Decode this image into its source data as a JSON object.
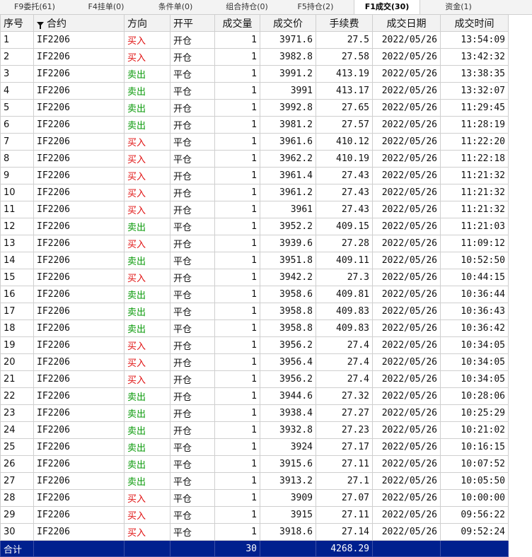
{
  "tabs": [
    {
      "label": "F9委托(61)",
      "active": false
    },
    {
      "label": "F4挂单(0)",
      "active": false
    },
    {
      "label": "条件单(0)",
      "active": false
    },
    {
      "label": "组合持仓(0)",
      "active": false
    },
    {
      "label": "F5持仓(2)",
      "active": false
    },
    {
      "label": "F1成交(30)",
      "active": true
    },
    {
      "label": "资金(1)",
      "active": false
    }
  ],
  "columns": [
    "序号",
    "合约",
    "方向",
    "开平",
    "成交量",
    "成交价",
    "手续费",
    "成交日期",
    "成交时间"
  ],
  "colors": {
    "buy": "#e01010",
    "sell": "#0a9a0a",
    "total_bg": "#00208e"
  },
  "rows": [
    [
      "1",
      "IF2206",
      "买入",
      "开仓",
      "1",
      "3971.6",
      "27.5",
      "2022/05/26",
      "13:54:09"
    ],
    [
      "2",
      "IF2206",
      "买入",
      "开仓",
      "1",
      "3982.8",
      "27.58",
      "2022/05/26",
      "13:42:32"
    ],
    [
      "3",
      "IF2206",
      "卖出",
      "平仓",
      "1",
      "3991.2",
      "413.19",
      "2022/05/26",
      "13:38:35"
    ],
    [
      "4",
      "IF2206",
      "卖出",
      "平仓",
      "1",
      "3991",
      "413.17",
      "2022/05/26",
      "13:32:07"
    ],
    [
      "5",
      "IF2206",
      "卖出",
      "开仓",
      "1",
      "3992.8",
      "27.65",
      "2022/05/26",
      "11:29:45"
    ],
    [
      "6",
      "IF2206",
      "卖出",
      "开仓",
      "1",
      "3981.2",
      "27.57",
      "2022/05/26",
      "11:28:19"
    ],
    [
      "7",
      "IF2206",
      "买入",
      "平仓",
      "1",
      "3961.6",
      "410.12",
      "2022/05/26",
      "11:22:20"
    ],
    [
      "8",
      "IF2206",
      "买入",
      "平仓",
      "1",
      "3962.2",
      "410.19",
      "2022/05/26",
      "11:22:18"
    ],
    [
      "9",
      "IF2206",
      "买入",
      "开仓",
      "1",
      "3961.4",
      "27.43",
      "2022/05/26",
      "11:21:32"
    ],
    [
      "10",
      "IF2206",
      "买入",
      "开仓",
      "1",
      "3961.2",
      "27.43",
      "2022/05/26",
      "11:21:32"
    ],
    [
      "11",
      "IF2206",
      "买入",
      "开仓",
      "1",
      "3961",
      "27.43",
      "2022/05/26",
      "11:21:32"
    ],
    [
      "12",
      "IF2206",
      "卖出",
      "平仓",
      "1",
      "3952.2",
      "409.15",
      "2022/05/26",
      "11:21:03"
    ],
    [
      "13",
      "IF2206",
      "买入",
      "开仓",
      "1",
      "3939.6",
      "27.28",
      "2022/05/26",
      "11:09:12"
    ],
    [
      "14",
      "IF2206",
      "卖出",
      "平仓",
      "1",
      "3951.8",
      "409.11",
      "2022/05/26",
      "10:52:50"
    ],
    [
      "15",
      "IF2206",
      "买入",
      "开仓",
      "1",
      "3942.2",
      "27.3",
      "2022/05/26",
      "10:44:15"
    ],
    [
      "16",
      "IF2206",
      "卖出",
      "平仓",
      "1",
      "3958.6",
      "409.81",
      "2022/05/26",
      "10:36:44"
    ],
    [
      "17",
      "IF2206",
      "卖出",
      "平仓",
      "1",
      "3958.8",
      "409.83",
      "2022/05/26",
      "10:36:43"
    ],
    [
      "18",
      "IF2206",
      "卖出",
      "平仓",
      "1",
      "3958.8",
      "409.83",
      "2022/05/26",
      "10:36:42"
    ],
    [
      "19",
      "IF2206",
      "买入",
      "开仓",
      "1",
      "3956.2",
      "27.4",
      "2022/05/26",
      "10:34:05"
    ],
    [
      "20",
      "IF2206",
      "买入",
      "开仓",
      "1",
      "3956.4",
      "27.4",
      "2022/05/26",
      "10:34:05"
    ],
    [
      "21",
      "IF2206",
      "买入",
      "开仓",
      "1",
      "3956.2",
      "27.4",
      "2022/05/26",
      "10:34:05"
    ],
    [
      "22",
      "IF2206",
      "卖出",
      "开仓",
      "1",
      "3944.6",
      "27.32",
      "2022/05/26",
      "10:28:06"
    ],
    [
      "23",
      "IF2206",
      "卖出",
      "开仓",
      "1",
      "3938.4",
      "27.27",
      "2022/05/26",
      "10:25:29"
    ],
    [
      "24",
      "IF2206",
      "卖出",
      "开仓",
      "1",
      "3932.8",
      "27.23",
      "2022/05/26",
      "10:21:02"
    ],
    [
      "25",
      "IF2206",
      "卖出",
      "平仓",
      "1",
      "3924",
      "27.17",
      "2022/05/26",
      "10:16:15"
    ],
    [
      "26",
      "IF2206",
      "卖出",
      "平仓",
      "1",
      "3915.6",
      "27.11",
      "2022/05/26",
      "10:07:52"
    ],
    [
      "27",
      "IF2206",
      "卖出",
      "平仓",
      "1",
      "3913.2",
      "27.1",
      "2022/05/26",
      "10:05:50"
    ],
    [
      "28",
      "IF2206",
      "买入",
      "平仓",
      "1",
      "3909",
      "27.07",
      "2022/05/26",
      "10:00:00"
    ],
    [
      "29",
      "IF2206",
      "买入",
      "平仓",
      "1",
      "3915",
      "27.11",
      "2022/05/26",
      "09:56:22"
    ],
    [
      "30",
      "IF2206",
      "买入",
      "平仓",
      "1",
      "3918.6",
      "27.14",
      "2022/05/26",
      "09:52:24"
    ]
  ],
  "total": {
    "label": "合计",
    "volume": "30",
    "fee": "4268.29"
  }
}
